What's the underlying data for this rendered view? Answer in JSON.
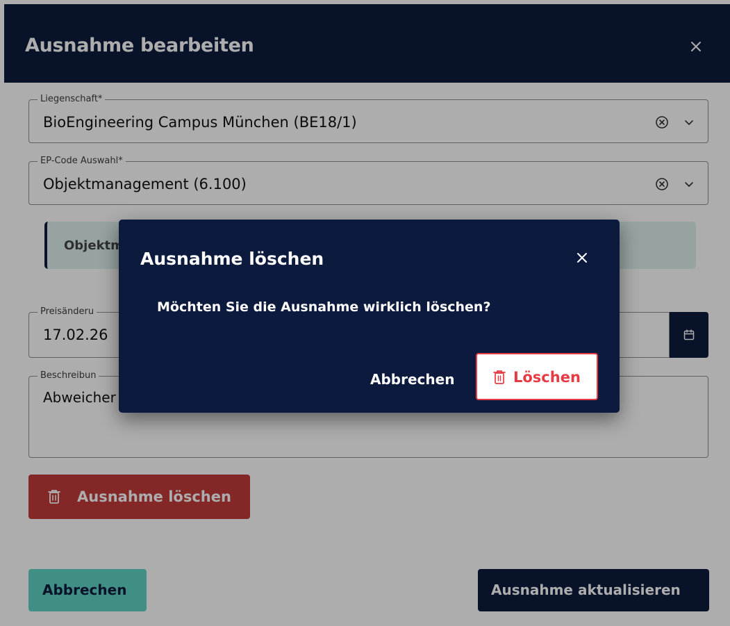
{
  "dialog": {
    "title": "Ausnahme bearbeiten",
    "fields": {
      "property": {
        "label": "Liegenschaft*",
        "value": "BioEngineering Campus München (BE18/1)"
      },
      "ep_code": {
        "label": "EP-Code Auswahl*",
        "value": "Objektmanagement (6.100)"
      },
      "price_change_date": {
        "label": "Preisänderu",
        "value": "17.02.26"
      },
      "description": {
        "label": "Beschreibun",
        "value": "Abweicher"
      }
    },
    "info_text": "Objektm",
    "delete_button": "Ausnahme löschen",
    "cancel_button": "Abbrechen",
    "update_button": "Ausnahme aktualisieren"
  },
  "confirm": {
    "title": "Ausnahme löschen",
    "message": "Möchten Sie die Ausnahme wirklich löschen?",
    "cancel": "Abbrechen",
    "confirm": "Löschen"
  },
  "colors": {
    "navy": "#0c1b3d",
    "teal": "#5fd3c4",
    "danger": "#c13a3a",
    "danger_text": "#e63b45",
    "info_bg": "#ddf0ec"
  },
  "icons": {
    "close": "close-icon",
    "clear": "clear-circle-x-icon",
    "dropdown": "chevron-down-icon",
    "calendar": "calendar-icon",
    "trash": "trash-icon"
  }
}
